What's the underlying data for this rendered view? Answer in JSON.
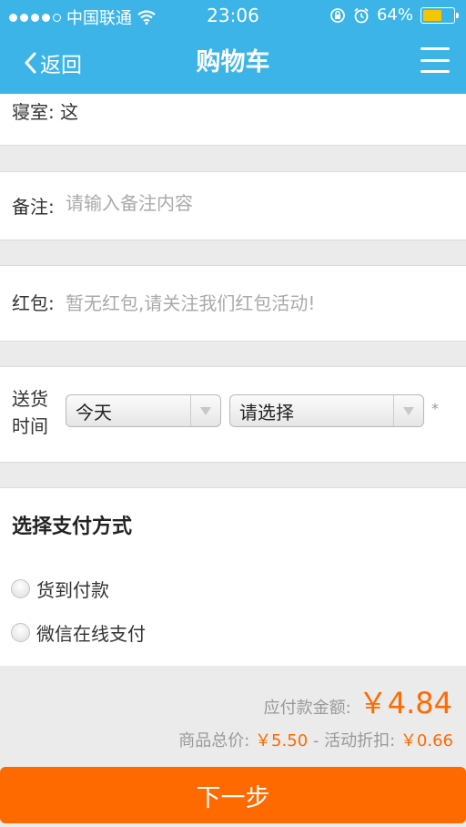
{
  "status_bar": {
    "carrier": "中国联通",
    "time": "23:06",
    "battery": "64%",
    "battery_level": 0.64
  },
  "nav": {
    "back_label": "返回",
    "title": "购物车"
  },
  "dorm": {
    "label": "寝室:",
    "value": "这"
  },
  "remark": {
    "label": "备注:",
    "placeholder": "请输入备注内容"
  },
  "red_packet": {
    "label": "红包:",
    "text": "暂无红包,请关注我们红包活动!"
  },
  "delivery": {
    "label_line1": "送货",
    "label_line2": "时间",
    "day_select": "今天",
    "time_select": "请选择",
    "required_mark": "*"
  },
  "payment": {
    "title": "选择支付方式",
    "options": [
      {
        "label": "货到付款",
        "selected": false
      },
      {
        "label": "微信在线支付",
        "selected": false
      }
    ]
  },
  "summary": {
    "payable_label": "应付款金额:",
    "payable_amount": "￥4.84",
    "subtotal_label": "商品总价:",
    "subtotal_value": "￥5.50",
    "separator": "-",
    "discount_label": "活动折扣:",
    "discount_value": "￥0.66"
  },
  "next_button": "下一步",
  "colors": {
    "header": "#3cb4e7",
    "accent": "#ff6a00"
  }
}
